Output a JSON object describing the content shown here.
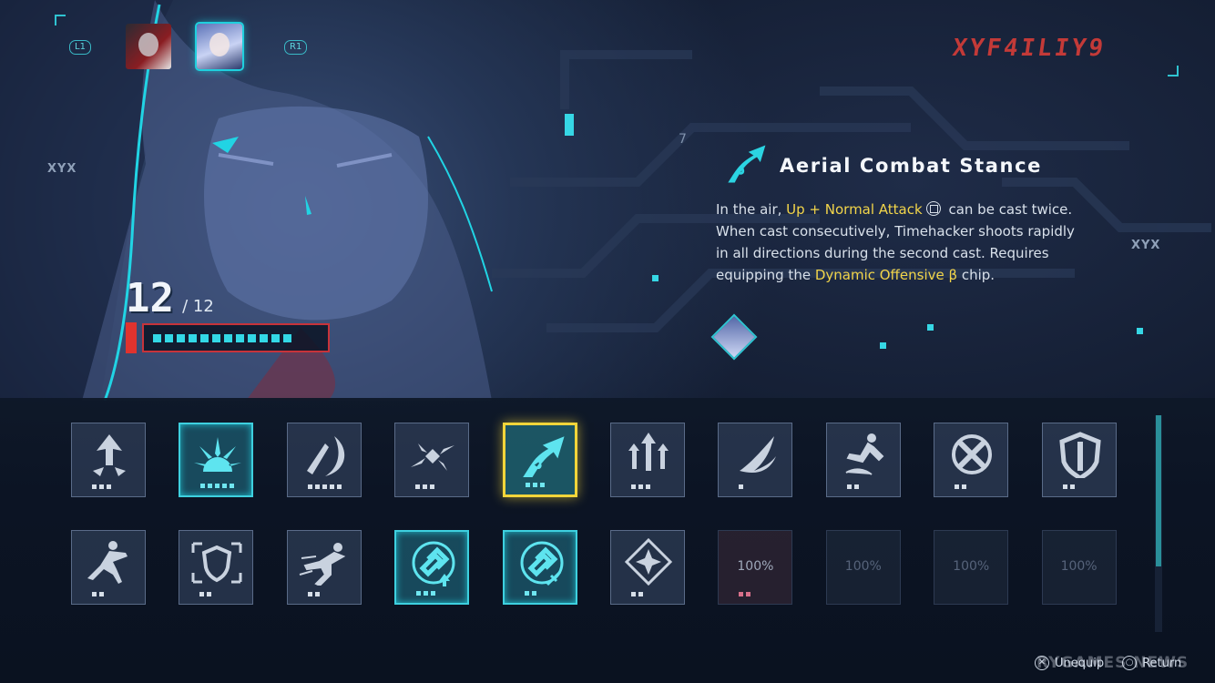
{
  "header": {
    "left_bumper": "L1",
    "right_bumper": "R1",
    "logo_text": "XYF4ILIY9",
    "side_mark": "XYX"
  },
  "characters": [
    {
      "name_icon": "character-portrait-dark-hair"
    },
    {
      "name_icon": "character-portrait-silver-hair",
      "active": true
    }
  ],
  "counter": {
    "current": "12",
    "max": "/ 12",
    "segments": 12
  },
  "detail": {
    "number": "7",
    "title": "Aerial Combat Stance",
    "body_prefix": "In the air, ",
    "body_highlight1": "Up + Normal Attack",
    "body_mid1": " can be cast twice. When cast consecutively, Timehacker shoots rapidly in all directions during the second cast. Requires equipping the ",
    "body_highlight2": "Dynamic Offensive β",
    "body_suffix": " chip.",
    "highlight_color": "#f2d54a"
  },
  "tiles_row1": [
    {
      "icon": "upward-arrow-burst-icon",
      "dots": 3,
      "state": "normal"
    },
    {
      "icon": "sunrise-burst-icon",
      "dots": 5,
      "state": "cyan"
    },
    {
      "icon": "crescent-slash-icon",
      "dots": 5,
      "state": "normal"
    },
    {
      "icon": "shatter-burst-icon",
      "dots": 3,
      "state": "normal"
    },
    {
      "icon": "aerial-arrow-icon",
      "dots": 3,
      "state": "selected"
    },
    {
      "icon": "triple-arrow-icon",
      "dots": 3,
      "state": "normal"
    },
    {
      "icon": "wing-slash-icon",
      "dots": 1,
      "state": "normal"
    },
    {
      "icon": "kick-figure-icon",
      "dots": 2,
      "state": "normal"
    },
    {
      "icon": "crossed-swords-icon",
      "dots": 2,
      "state": "normal"
    },
    {
      "icon": "shield-icon",
      "dots": 2,
      "state": "normal"
    }
  ],
  "tiles_row2": [
    {
      "icon": "lunge-figure-icon",
      "dots": 2,
      "state": "normal"
    },
    {
      "icon": "guard-shield-icon",
      "dots": 2,
      "state": "normal"
    },
    {
      "icon": "dash-figure-icon",
      "dots": 2,
      "state": "normal"
    },
    {
      "icon": "chain-link-up-icon",
      "dots": 3,
      "state": "cyan"
    },
    {
      "icon": "chain-link-sword-icon",
      "dots": 2,
      "state": "cyan"
    },
    {
      "icon": "compass-diamond-icon",
      "dots": 2,
      "state": "normal"
    },
    {
      "pct": "100%",
      "dots": 2,
      "state": "dim-red"
    },
    {
      "pct": "100%",
      "dots": 0,
      "state": "dim"
    },
    {
      "pct": "100%",
      "dots": 0,
      "state": "dim"
    },
    {
      "pct": "100%",
      "dots": 0,
      "state": "dim"
    }
  ],
  "footer": {
    "unequip_label": "Unequip",
    "return_label": "Return",
    "unequip_glyph": "✕",
    "return_glyph": "○"
  },
  "watermark": "RYGAMES NEWS"
}
